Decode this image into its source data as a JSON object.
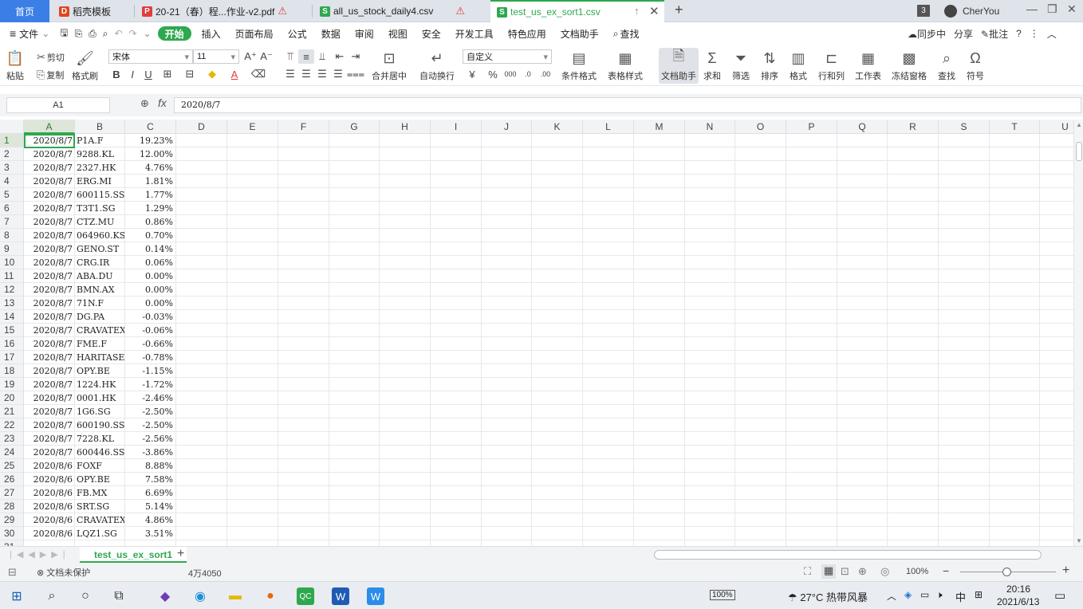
{
  "tabs": {
    "home": "首页",
    "t1": "稻壳模板",
    "t2": "20-21（春）程...作业-v2.pdf",
    "t3": "all_us_stock_daily4.csv",
    "t4": "test_us_ex_sort1.csv",
    "window_count": "3",
    "user": "CherYou"
  },
  "menu": {
    "file": "文件",
    "items": [
      "开始",
      "插入",
      "页面布局",
      "公式",
      "数据",
      "审阅",
      "视图",
      "安全",
      "开发工具",
      "特色应用",
      "文档助手"
    ],
    "search": "查找",
    "sync": "同步中",
    "share": "分享",
    "comment": "批注"
  },
  "ribbon": {
    "paste": "粘贴",
    "cut": "剪切",
    "copy": "复制",
    "format_painter": "格式刷",
    "font_name": "宋体",
    "font_size": "11",
    "merge": "合并居中",
    "wrap": "自动换行",
    "number_format": "自定义",
    "cond_format": "条件格式",
    "table_style": "表格样式",
    "doc_helper": "文档助手",
    "sum": "求和",
    "filter": "筛选",
    "sort": "排序",
    "format": "格式",
    "rowcol": "行和列",
    "sheet": "工作表",
    "freeze": "冻结窗格",
    "find": "查找",
    "symbol": "符号"
  },
  "formula": {
    "cell_ref": "A1",
    "fx": "fx",
    "value": "2020/8/7"
  },
  "columns": [
    "A",
    "B",
    "C",
    "D",
    "E",
    "F",
    "G",
    "H",
    "I",
    "J",
    "K",
    "L",
    "M",
    "N",
    "O",
    "P",
    "Q",
    "R",
    "S",
    "T",
    "U"
  ],
  "rows": [
    [
      "2020/8/7",
      "P1A.F",
      "19.23%"
    ],
    [
      "2020/8/7",
      "9288.KL",
      "12.00%"
    ],
    [
      "2020/8/7",
      "2327.HK",
      "4.76%"
    ],
    [
      "2020/8/7",
      "ERG.MI",
      "1.81%"
    ],
    [
      "2020/8/7",
      "600115.SS",
      "1.77%"
    ],
    [
      "2020/8/7",
      "T3T1.SG",
      "1.29%"
    ],
    [
      "2020/8/7",
      "CTZ.MU",
      "0.86%"
    ],
    [
      "2020/8/7",
      "064960.KS",
      "0.70%"
    ],
    [
      "2020/8/7",
      "GENO.ST",
      "0.14%"
    ],
    [
      "2020/8/7",
      "CRG.IR",
      "0.06%"
    ],
    [
      "2020/8/7",
      "ABA.DU",
      "0.00%"
    ],
    [
      "2020/8/7",
      "BMN.AX",
      "0.00%"
    ],
    [
      "2020/8/7",
      "71N.F",
      "0.00%"
    ],
    [
      "2020/8/7",
      "DG.PA",
      "-0.03%"
    ],
    [
      "2020/8/7",
      "CRAVATEX.E",
      "-0.06%"
    ],
    [
      "2020/8/7",
      "FME.F",
      "-0.66%"
    ],
    [
      "2020/8/7",
      "HARITASEAT",
      "-0.78%"
    ],
    [
      "2020/8/7",
      "OPY.BE",
      "-1.15%"
    ],
    [
      "2020/8/7",
      "1224.HK",
      "-1.72%"
    ],
    [
      "2020/8/7",
      "0001.HK",
      "-2.46%"
    ],
    [
      "2020/8/7",
      "1G6.SG",
      "-2.50%"
    ],
    [
      "2020/8/7",
      "600190.SS",
      "-2.50%"
    ],
    [
      "2020/8/7",
      "7228.KL",
      "-2.56%"
    ],
    [
      "2020/8/7",
      "600446.SS",
      "-3.86%"
    ],
    [
      "2020/8/6",
      "FOXF",
      "8.88%"
    ],
    [
      "2020/8/6",
      "OPY.BE",
      "7.58%"
    ],
    [
      "2020/8/6",
      "FB.MX",
      "6.69%"
    ],
    [
      "2020/8/6",
      "SRT.SG",
      "5.14%"
    ],
    [
      "2020/8/6",
      "CRAVATEX.E",
      "4.86%"
    ],
    [
      "2020/8/6",
      "LQZ1.SG",
      "3.51%"
    ]
  ],
  "sheet": {
    "name": "test_us_ex_sort1",
    "add": "+"
  },
  "status": {
    "protect": "文档未保护",
    "count": "4万4050",
    "zoom": "100%"
  },
  "taskbar": {
    "battery": "100%",
    "weather": "27°C 热带风暴",
    "ime": "中",
    "time": "20:16",
    "date": "2021/6/13"
  },
  "colors": {
    "accent": "#2ea84f",
    "home_tab": "#3b7fe6"
  }
}
